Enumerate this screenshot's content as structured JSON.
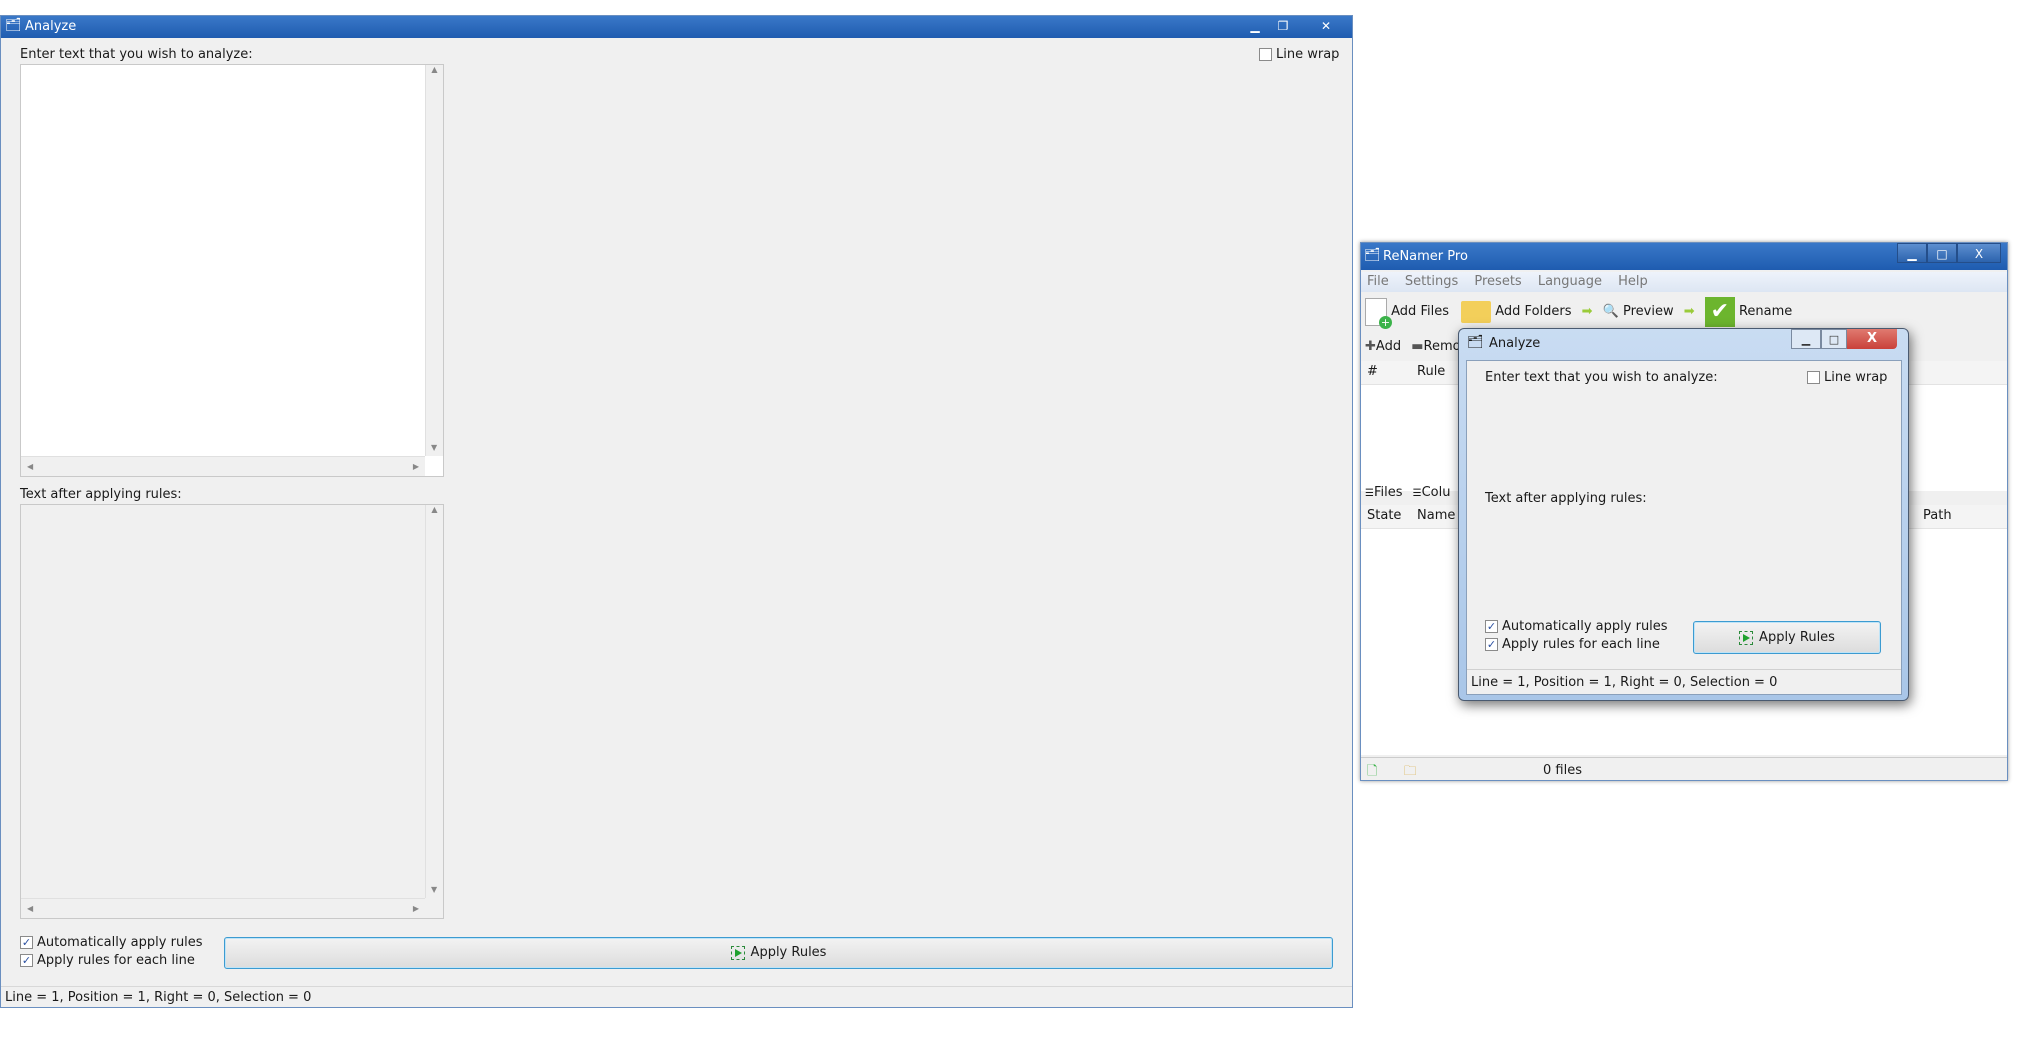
{
  "analyze_main": {
    "title": "Analyze",
    "input_label": "Enter text that you wish to analyze:",
    "line_wrap_label": "Line wrap",
    "line_wrap_checked": false,
    "output_label": "Text after applying rules:",
    "auto_apply_label": "Automatically apply rules",
    "auto_apply_checked": true,
    "each_line_label": "Apply rules for each line",
    "each_line_checked": true,
    "apply_button": "Apply Rules",
    "status": "Line = 1, Position = 1, Right = 0, Selection = 0",
    "window_buttons": {
      "minimize": "▁",
      "maximize": "❐",
      "close": "✕"
    }
  },
  "renamer": {
    "title": "ReNamer Pro",
    "menu": [
      "File",
      "Settings",
      "Presets",
      "Language",
      "Help"
    ],
    "toolbar": {
      "add_files": "Add Files",
      "add_folders": "Add Folders",
      "preview": "Preview",
      "rename": "Rename"
    },
    "rules_toolbar": {
      "add": "Add",
      "remove": "Remo"
    },
    "rules_columns": [
      "#",
      "Rule"
    ],
    "files_toolbar": {
      "files": "Files",
      "columns": "Colu"
    },
    "files_columns": [
      "State",
      "Name",
      "Path"
    ],
    "status_files": "0 files",
    "window_buttons": {
      "minimize": "▁",
      "maximize": "□",
      "close": "X"
    }
  },
  "analyze_dialog": {
    "title": "Analyze",
    "input_label": "Enter text that you wish to analyze:",
    "line_wrap_label": "Line wrap",
    "output_label": "Text after applying rules:",
    "auto_apply_label": "Automatically apply rules",
    "each_line_label": "Apply rules for each line",
    "apply_button": "Apply Rules",
    "status": "Line = 1, Position = 1, Right = 0, Selection = 0",
    "window_buttons": {
      "minimize": "▁",
      "maximize": "□",
      "close": "X"
    }
  },
  "colors": {
    "titlebar": "#2a66b8",
    "client": "#f0f0f0",
    "button_border": "#3c9bd1",
    "close_red": "#c9413a"
  }
}
